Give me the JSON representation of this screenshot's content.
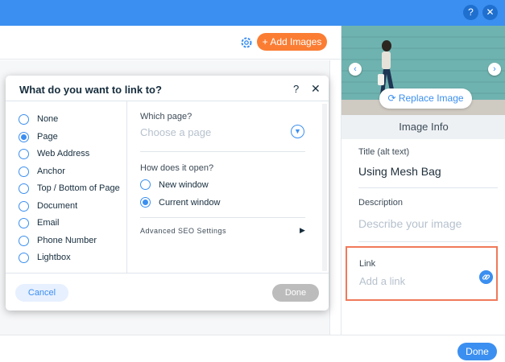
{
  "topbar": {
    "help_icon": "?",
    "close_icon": "✕"
  },
  "toolbar": {
    "add_images_label": "Add Images",
    "add_icon": "+"
  },
  "image_panel": {
    "replace_image_label": "Replace Image",
    "info_heading": "Image Info",
    "title_label": "Title (alt text)",
    "title_value": "Using Mesh Bag",
    "description_label": "Description",
    "description_placeholder": "Describe your image",
    "link_label": "Link",
    "link_placeholder": "Add a link"
  },
  "footer": {
    "done_label": "Done"
  },
  "dialog": {
    "title": "What do you want to link to?",
    "help": "?",
    "close": "✕",
    "options": [
      "None",
      "Page",
      "Web Address",
      "Anchor",
      "Top / Bottom of Page",
      "Document",
      "Email",
      "Phone Number",
      "Lightbox"
    ],
    "selected_option": "Page",
    "which_page_label": "Which page?",
    "choose_page_placeholder": "Choose a page",
    "how_open_label": "How does it open?",
    "open_options": [
      "New window",
      "Current window"
    ],
    "selected_open": "Current window",
    "advanced_label": "Advanced SEO Settings",
    "cancel_label": "Cancel",
    "done_label": "Done"
  },
  "colors": {
    "accent": "#3b8ff0",
    "orange": "#fb7d33",
    "highlight": "#f0795a"
  }
}
